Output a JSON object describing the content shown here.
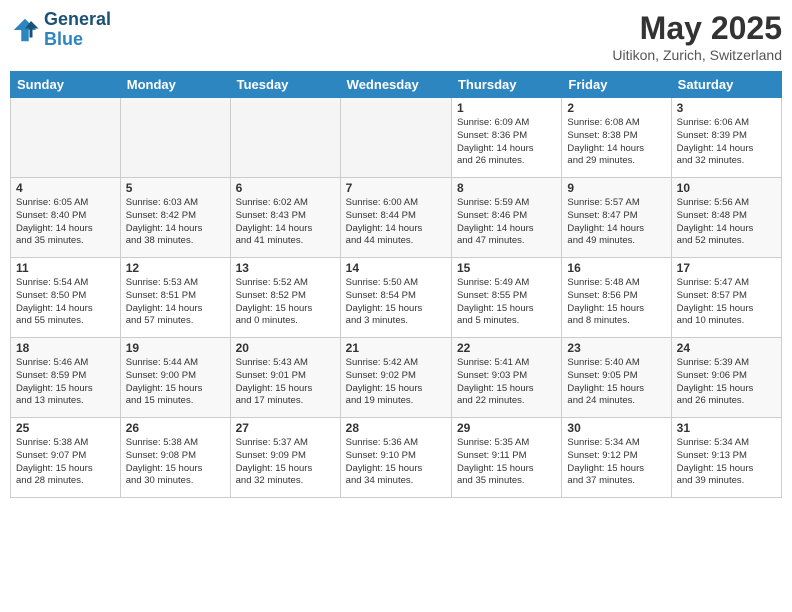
{
  "header": {
    "logo_line1": "General",
    "logo_line2": "Blue",
    "month_title": "May 2025",
    "location": "Uitikon, Zurich, Switzerland"
  },
  "weekdays": [
    "Sunday",
    "Monday",
    "Tuesday",
    "Wednesday",
    "Thursday",
    "Friday",
    "Saturday"
  ],
  "weeks": [
    [
      {
        "day": "",
        "info": "",
        "empty": true
      },
      {
        "day": "",
        "info": "",
        "empty": true
      },
      {
        "day": "",
        "info": "",
        "empty": true
      },
      {
        "day": "",
        "info": "",
        "empty": true
      },
      {
        "day": "1",
        "info": "Sunrise: 6:09 AM\nSunset: 8:36 PM\nDaylight: 14 hours\nand 26 minutes.",
        "empty": false
      },
      {
        "day": "2",
        "info": "Sunrise: 6:08 AM\nSunset: 8:38 PM\nDaylight: 14 hours\nand 29 minutes.",
        "empty": false
      },
      {
        "day": "3",
        "info": "Sunrise: 6:06 AM\nSunset: 8:39 PM\nDaylight: 14 hours\nand 32 minutes.",
        "empty": false
      }
    ],
    [
      {
        "day": "4",
        "info": "Sunrise: 6:05 AM\nSunset: 8:40 PM\nDaylight: 14 hours\nand 35 minutes.",
        "empty": false
      },
      {
        "day": "5",
        "info": "Sunrise: 6:03 AM\nSunset: 8:42 PM\nDaylight: 14 hours\nand 38 minutes.",
        "empty": false
      },
      {
        "day": "6",
        "info": "Sunrise: 6:02 AM\nSunset: 8:43 PM\nDaylight: 14 hours\nand 41 minutes.",
        "empty": false
      },
      {
        "day": "7",
        "info": "Sunrise: 6:00 AM\nSunset: 8:44 PM\nDaylight: 14 hours\nand 44 minutes.",
        "empty": false
      },
      {
        "day": "8",
        "info": "Sunrise: 5:59 AM\nSunset: 8:46 PM\nDaylight: 14 hours\nand 47 minutes.",
        "empty": false
      },
      {
        "day": "9",
        "info": "Sunrise: 5:57 AM\nSunset: 8:47 PM\nDaylight: 14 hours\nand 49 minutes.",
        "empty": false
      },
      {
        "day": "10",
        "info": "Sunrise: 5:56 AM\nSunset: 8:48 PM\nDaylight: 14 hours\nand 52 minutes.",
        "empty": false
      }
    ],
    [
      {
        "day": "11",
        "info": "Sunrise: 5:54 AM\nSunset: 8:50 PM\nDaylight: 14 hours\nand 55 minutes.",
        "empty": false
      },
      {
        "day": "12",
        "info": "Sunrise: 5:53 AM\nSunset: 8:51 PM\nDaylight: 14 hours\nand 57 minutes.",
        "empty": false
      },
      {
        "day": "13",
        "info": "Sunrise: 5:52 AM\nSunset: 8:52 PM\nDaylight: 15 hours\nand 0 minutes.",
        "empty": false
      },
      {
        "day": "14",
        "info": "Sunrise: 5:50 AM\nSunset: 8:54 PM\nDaylight: 15 hours\nand 3 minutes.",
        "empty": false
      },
      {
        "day": "15",
        "info": "Sunrise: 5:49 AM\nSunset: 8:55 PM\nDaylight: 15 hours\nand 5 minutes.",
        "empty": false
      },
      {
        "day": "16",
        "info": "Sunrise: 5:48 AM\nSunset: 8:56 PM\nDaylight: 15 hours\nand 8 minutes.",
        "empty": false
      },
      {
        "day": "17",
        "info": "Sunrise: 5:47 AM\nSunset: 8:57 PM\nDaylight: 15 hours\nand 10 minutes.",
        "empty": false
      }
    ],
    [
      {
        "day": "18",
        "info": "Sunrise: 5:46 AM\nSunset: 8:59 PM\nDaylight: 15 hours\nand 13 minutes.",
        "empty": false
      },
      {
        "day": "19",
        "info": "Sunrise: 5:44 AM\nSunset: 9:00 PM\nDaylight: 15 hours\nand 15 minutes.",
        "empty": false
      },
      {
        "day": "20",
        "info": "Sunrise: 5:43 AM\nSunset: 9:01 PM\nDaylight: 15 hours\nand 17 minutes.",
        "empty": false
      },
      {
        "day": "21",
        "info": "Sunrise: 5:42 AM\nSunset: 9:02 PM\nDaylight: 15 hours\nand 19 minutes.",
        "empty": false
      },
      {
        "day": "22",
        "info": "Sunrise: 5:41 AM\nSunset: 9:03 PM\nDaylight: 15 hours\nand 22 minutes.",
        "empty": false
      },
      {
        "day": "23",
        "info": "Sunrise: 5:40 AM\nSunset: 9:05 PM\nDaylight: 15 hours\nand 24 minutes.",
        "empty": false
      },
      {
        "day": "24",
        "info": "Sunrise: 5:39 AM\nSunset: 9:06 PM\nDaylight: 15 hours\nand 26 minutes.",
        "empty": false
      }
    ],
    [
      {
        "day": "25",
        "info": "Sunrise: 5:38 AM\nSunset: 9:07 PM\nDaylight: 15 hours\nand 28 minutes.",
        "empty": false
      },
      {
        "day": "26",
        "info": "Sunrise: 5:38 AM\nSunset: 9:08 PM\nDaylight: 15 hours\nand 30 minutes.",
        "empty": false
      },
      {
        "day": "27",
        "info": "Sunrise: 5:37 AM\nSunset: 9:09 PM\nDaylight: 15 hours\nand 32 minutes.",
        "empty": false
      },
      {
        "day": "28",
        "info": "Sunrise: 5:36 AM\nSunset: 9:10 PM\nDaylight: 15 hours\nand 34 minutes.",
        "empty": false
      },
      {
        "day": "29",
        "info": "Sunrise: 5:35 AM\nSunset: 9:11 PM\nDaylight: 15 hours\nand 35 minutes.",
        "empty": false
      },
      {
        "day": "30",
        "info": "Sunrise: 5:34 AM\nSunset: 9:12 PM\nDaylight: 15 hours\nand 37 minutes.",
        "empty": false
      },
      {
        "day": "31",
        "info": "Sunrise: 5:34 AM\nSunset: 9:13 PM\nDaylight: 15 hours\nand 39 minutes.",
        "empty": false
      }
    ]
  ]
}
